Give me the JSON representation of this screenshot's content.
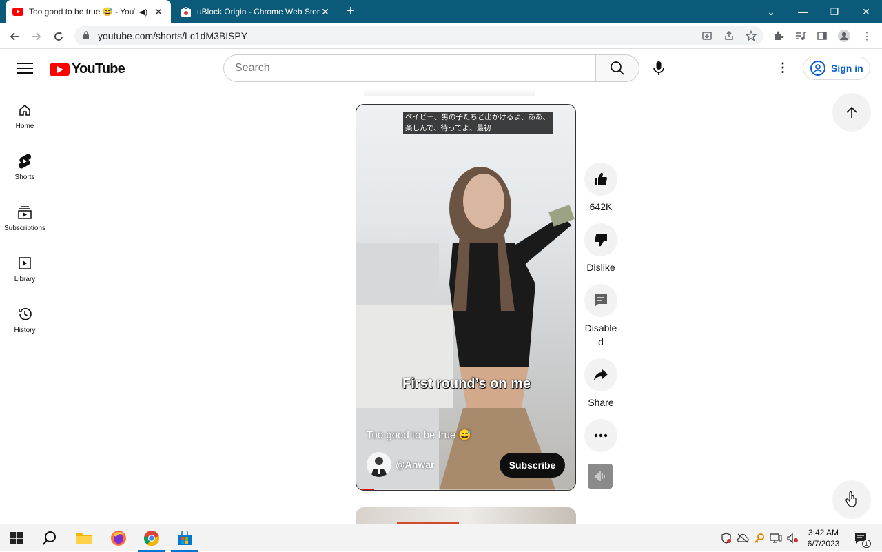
{
  "browser": {
    "tabs": [
      {
        "title": "Too good to be true 😅 - YouTube",
        "active": true
      },
      {
        "title": "uBlock Origin - Chrome Web Store",
        "active": false
      }
    ],
    "url": "youtube.com/shorts/Lc1dM3BISPY"
  },
  "header": {
    "logo_text": "YouTube",
    "search_placeholder": "Search",
    "signin_label": "Sign in"
  },
  "sidebar": {
    "items": [
      {
        "label": "Home",
        "icon": "home-icon"
      },
      {
        "label": "Shorts",
        "icon": "shorts-icon"
      },
      {
        "label": "Subscriptions",
        "icon": "subscriptions-icon"
      },
      {
        "label": "Library",
        "icon": "library-icon"
      },
      {
        "label": "History",
        "icon": "history-icon"
      }
    ]
  },
  "short": {
    "subtitle_jp": "ベイビー、男の子たちと出かけるよ、ああ、楽しんで、待ってよ、最初",
    "overlay_text": "First round’s on me",
    "title": "Too good to be true 😅",
    "channel": "@Anwar",
    "subscribe_label": "Subscribe",
    "progress": 0.08
  },
  "actions": {
    "like_count": "642K",
    "dislike_label": "Dislike",
    "comments_label": "Disabled",
    "share_label": "Share"
  },
  "taskbar": {
    "time": "3:42 AM",
    "date": "6/7/2023",
    "notification_count": "1"
  },
  "colors": {
    "yt_red": "#ff0000",
    "link_blue": "#065fd4",
    "tabstrip": "#0b5a7a"
  }
}
